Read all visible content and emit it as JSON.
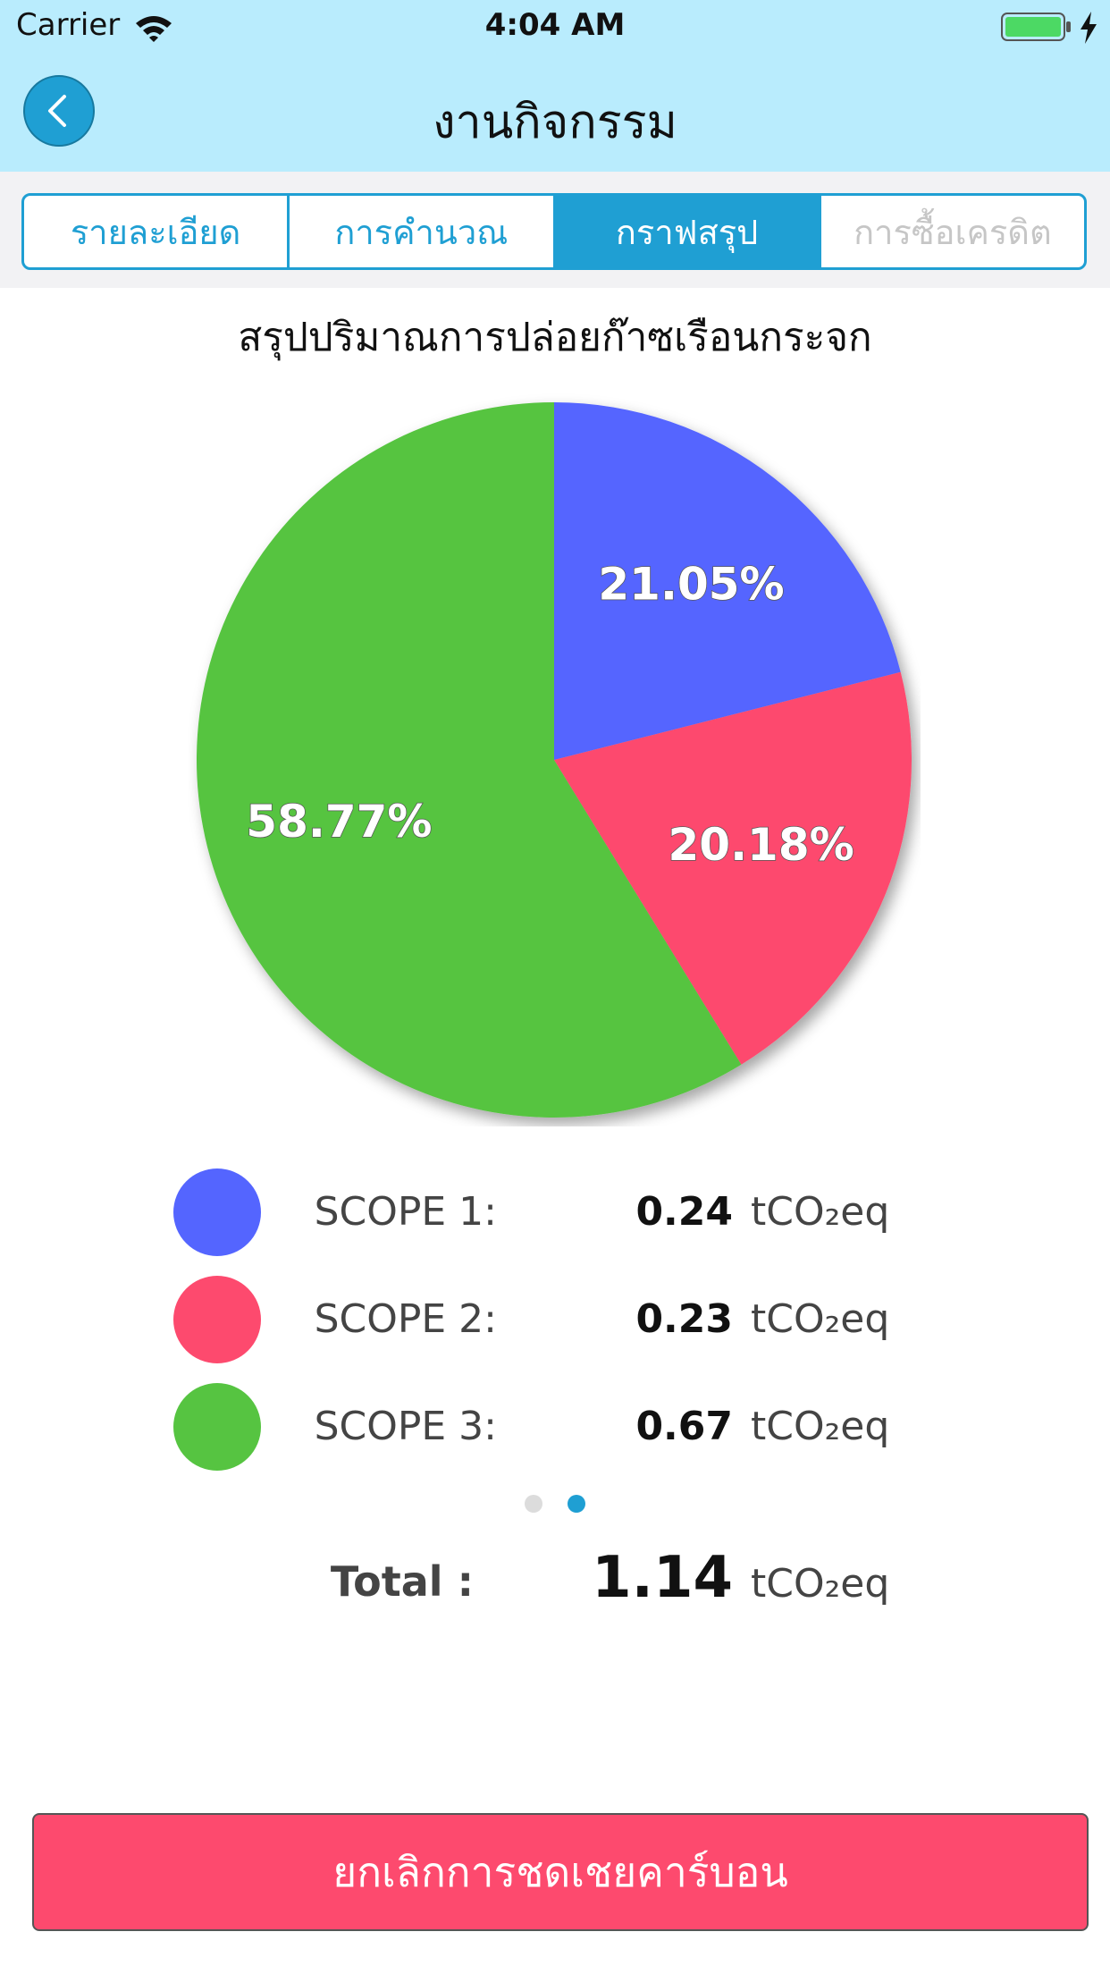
{
  "status_bar": {
    "carrier": "Carrier",
    "time": "4:04 AM",
    "battery_color": "#4cd964"
  },
  "header": {
    "title": "งานกิจกรรม",
    "back_icon": "chevron-left-icon"
  },
  "tabs": [
    {
      "label": "รายละเอียด",
      "state": "normal"
    },
    {
      "label": "การคำนวณ",
      "state": "normal"
    },
    {
      "label": "กราฟสรุป",
      "state": "selected"
    },
    {
      "label": "การซื้อเครดิต",
      "state": "disabled"
    }
  ],
  "summary": {
    "title": "สรุปปริมาณการปล่อยก๊าซเรือนกระจก",
    "scopes": [
      {
        "label": "SCOPE 1:",
        "value": "0.24",
        "unit": "tCO₂eq",
        "color": "#5465ff"
      },
      {
        "label": "SCOPE 2:",
        "value": "0.23",
        "unit": "tCO₂eq",
        "color": "#fd4a6e"
      },
      {
        "label": "SCOPE 3:",
        "value": "0.67",
        "unit": "tCO₂eq",
        "color": "#56c441"
      }
    ],
    "total_label": "Total :",
    "total_value": "1.14",
    "total_unit": "tCO₂eq",
    "pager": {
      "count": 2,
      "current": 2
    }
  },
  "chart_data": {
    "type": "pie",
    "title": "สรุปปริมาณการปล่อยก๊าซเรือนกระจก",
    "slices": [
      {
        "label": "SCOPE 1",
        "value": 21.05,
        "display": "21.05%",
        "color": "#5465ff"
      },
      {
        "label": "SCOPE 2",
        "value": 20.18,
        "display": "20.18%",
        "color": "#fd4a6e"
      },
      {
        "label": "SCOPE 3",
        "value": 58.77,
        "display": "58.77%",
        "color": "#56c441"
      }
    ],
    "start": "12 o'clock",
    "direction": "clockwise"
  },
  "actions": {
    "cancel_label": "ยกเลิกการชดเชยคาร์บอน"
  }
}
